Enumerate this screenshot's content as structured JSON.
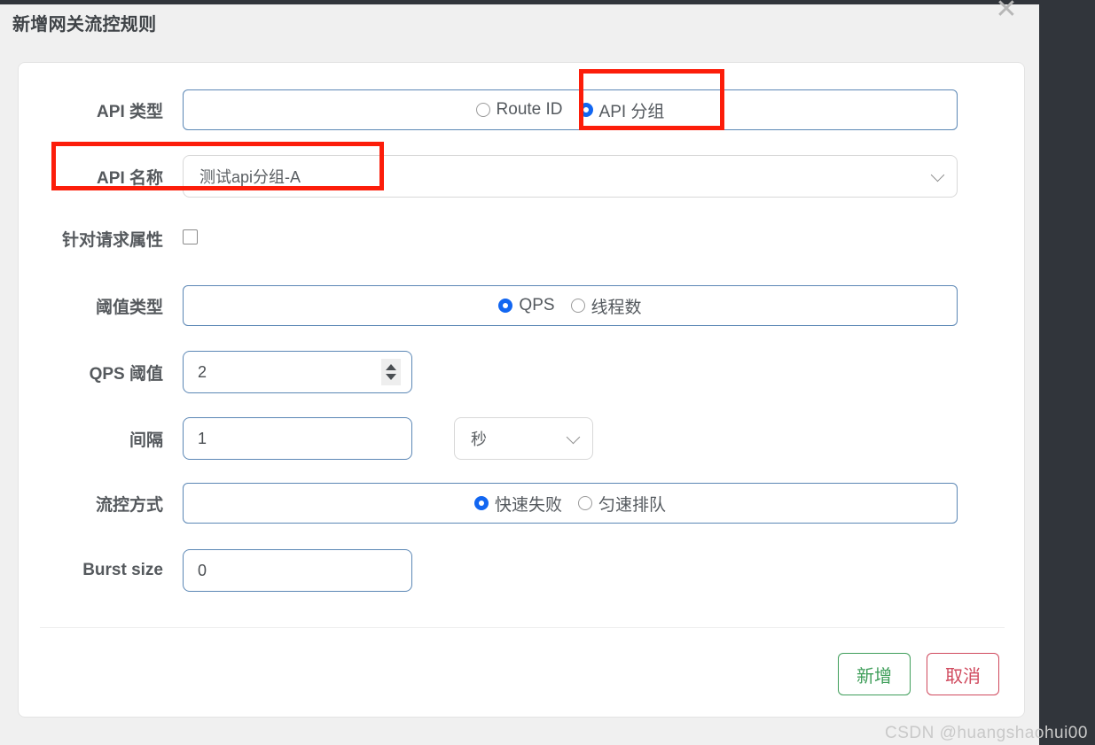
{
  "dialog": {
    "title": "新增网关流控规则",
    "close_icon": "close-icon"
  },
  "form": {
    "api_type": {
      "label": "API 类型",
      "options": [
        {
          "label": "Route ID",
          "selected": false
        },
        {
          "label": "API 分组",
          "selected": true
        }
      ]
    },
    "api_name": {
      "label": "API 名称",
      "value": "测试api分组-A"
    },
    "request_attr": {
      "label": "针对请求属性",
      "checked": false
    },
    "threshold_type": {
      "label": "阈值类型",
      "options": [
        {
          "label": "QPS",
          "selected": true
        },
        {
          "label": "线程数",
          "selected": false
        }
      ]
    },
    "qps_threshold": {
      "label": "QPS 阈值",
      "value": "2"
    },
    "interval": {
      "label": "间隔",
      "value": "1",
      "unit": "秒"
    },
    "flow_control": {
      "label": "流控方式",
      "options": [
        {
          "label": "快速失败",
          "selected": true
        },
        {
          "label": "匀速排队",
          "selected": false
        }
      ]
    },
    "burst_size": {
      "label": "Burst size",
      "value": "0"
    }
  },
  "buttons": {
    "submit": "新增",
    "cancel": "取消"
  },
  "watermark": "CSDN @huangshaohui00",
  "colors": {
    "accent": "#1266f1",
    "submit": "#3f9e5a",
    "cancel": "#d04a5e",
    "annotation": "#fc1d0a",
    "input_border": "#5b87b5"
  }
}
